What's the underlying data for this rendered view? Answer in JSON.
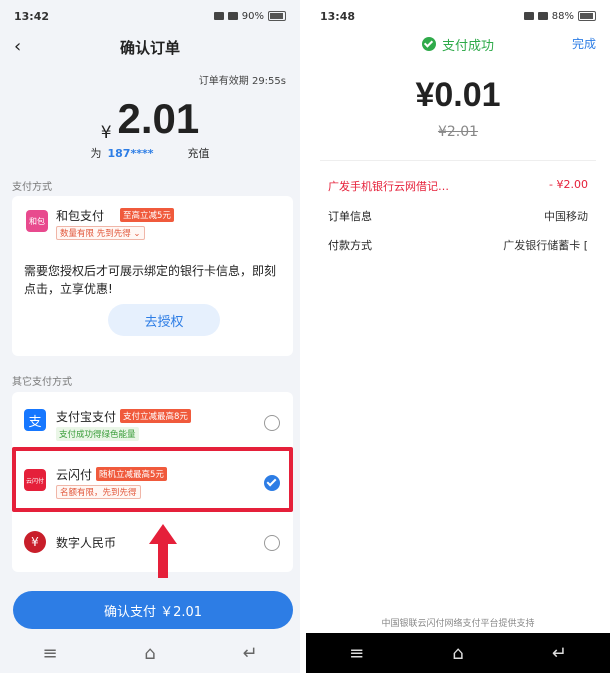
{
  "left": {
    "status": {
      "time": "13:42",
      "battery": "90%"
    },
    "header": {
      "title": "确认订单"
    },
    "expiry": "订单有效期 29:55s",
    "amount": {
      "symbol": "¥",
      "value": "2.01"
    },
    "recharge": {
      "prefix": "为",
      "number": "187****",
      "action": "充值"
    },
    "pay_method_label": "支付方式",
    "hebao": {
      "logo_text": "和包",
      "name": "和包支付",
      "promo": "至高立减5元",
      "limit": "数量有限 先到先得 ⌄",
      "desc": "需要您授权后才可展示绑定的银行卡信息，即刻点击，立享优惠!",
      "auth_button": "去授权"
    },
    "other_methods_label": "其它支付方式",
    "methods": [
      {
        "name": "支付宝支付",
        "promo": "支付立减最高8元",
        "sub": "支付成功得绿色能量",
        "checked": false,
        "logo": "支"
      },
      {
        "name": "云闪付",
        "promo": "随机立减最高5元",
        "sub": "名额有限，先到先得",
        "checked": true,
        "logo": "云闪付"
      },
      {
        "name": "数字人民币",
        "promo": "",
        "sub": "",
        "checked": false,
        "logo": "¥"
      }
    ],
    "confirm_button": "确认支付 ￥2.01"
  },
  "right": {
    "status": {
      "time": "13:48",
      "battery": "88%"
    },
    "success_text": "支付成功",
    "done_button": "完成",
    "paid_amount": "¥0.01",
    "original_amount": "¥2.01",
    "rows": [
      {
        "label": "广发手机银行云网借记…",
        "value": "- ¥2.00",
        "red": true
      },
      {
        "label": "订单信息",
        "value": "中国移动",
        "red": false
      },
      {
        "label": "付款方式",
        "value": "广发银行储蓄卡 [",
        "red": false
      }
    ],
    "footer": "中国银联云闪付网络支付平台提供支持"
  },
  "colors": {
    "accent": "#2d7de5",
    "highlight": "#e5203a",
    "success": "#2faa4a",
    "promo": "#f05a3c"
  }
}
